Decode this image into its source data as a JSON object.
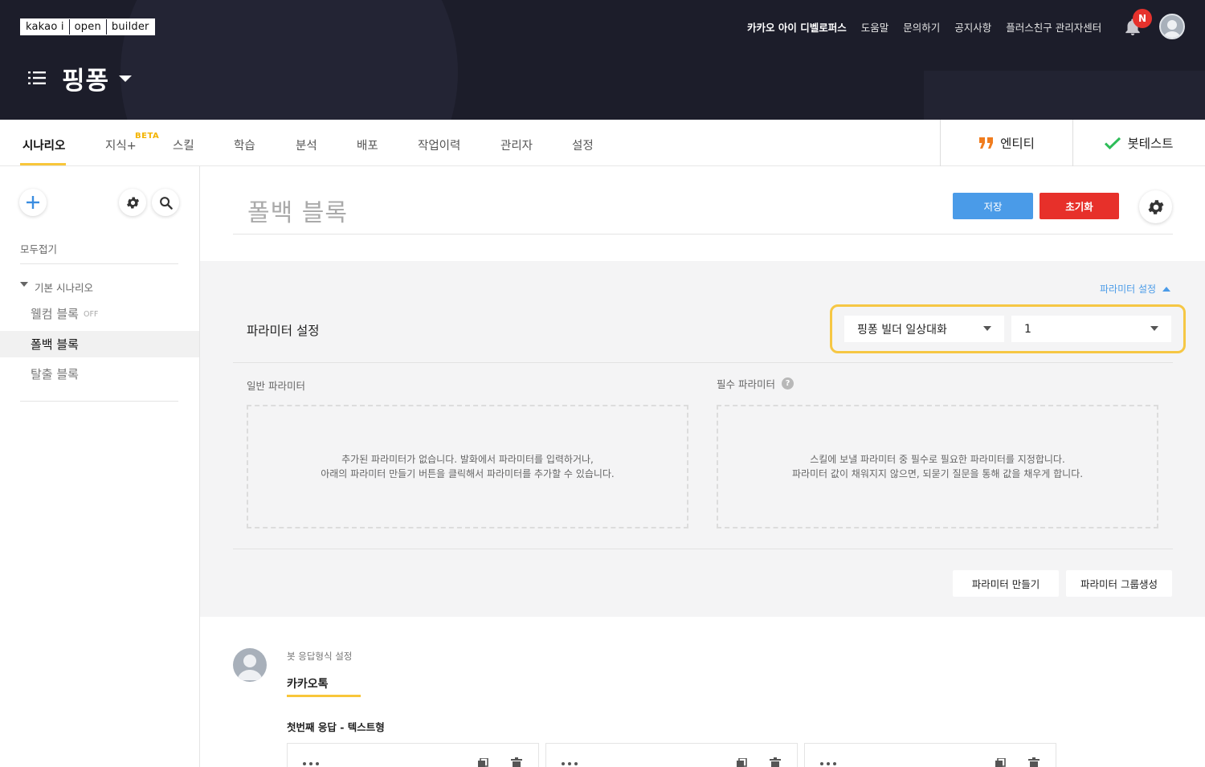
{
  "header": {
    "logo": [
      "kakao i",
      "open",
      "builder"
    ],
    "nav": [
      "카카오 아이 디벨로퍼스",
      "도움말",
      "문의하기",
      "공지사항",
      "플러스친구 관리자센터"
    ],
    "notification_badge": "N",
    "bot_name": "핑퐁"
  },
  "tabs": {
    "items": [
      "시나리오",
      "지식+",
      "스킬",
      "학습",
      "분석",
      "배포",
      "작업이력",
      "관리자",
      "설정"
    ],
    "beta": "BETA",
    "entity": "엔티티",
    "bot_test": "봇테스트"
  },
  "sidebar": {
    "collapse_all": "모두접기",
    "group": "기본 시나리오",
    "items": [
      {
        "label": "웰컴 블록",
        "tag": "OFF"
      },
      {
        "label": "폴백 블록"
      },
      {
        "label": "탈출 블록"
      }
    ]
  },
  "main": {
    "block_title": "폴백 블록",
    "save": "저장",
    "reset": "초기화"
  },
  "params": {
    "toggle": "파라미터 설정",
    "title": "파라미터 설정",
    "select1": "핑퐁 빌더 일상대화",
    "select2": "1",
    "general_label": "일반 파라미터",
    "required_label": "필수 파라미터",
    "help": "?",
    "general_empty_1": "추가된 파라미터가 없습니다. 발화에서 파라미터를 입력하거나,",
    "general_empty_2": "아래의 파라미터 만들기 버튼을 클릭해서 파라미터를 추가할 수 있습니다.",
    "required_empty_1": "스킬에 보낼 파라미터 중 필수로 필요한 파라미터를 지정합니다.",
    "required_empty_2": "파라미터 값이 채워지지 않으면, 되묻기 질문을 통해 값을 채우게 합니다.",
    "make_param": "파라미터 만들기",
    "make_group": "파라미터 그룹생성"
  },
  "response": {
    "label": "봇 응답형식 설정",
    "tab": "카카오톡",
    "first": "첫번째 응답 - 텍스트형"
  },
  "colors": {
    "header_bg": "#1c1d2a",
    "accent_yellow": "#f8c63a",
    "save_blue": "#4a9be8",
    "reset_red": "#e7302a",
    "entity_orange": "#f07c1e",
    "check_green": "#2ebd59"
  }
}
